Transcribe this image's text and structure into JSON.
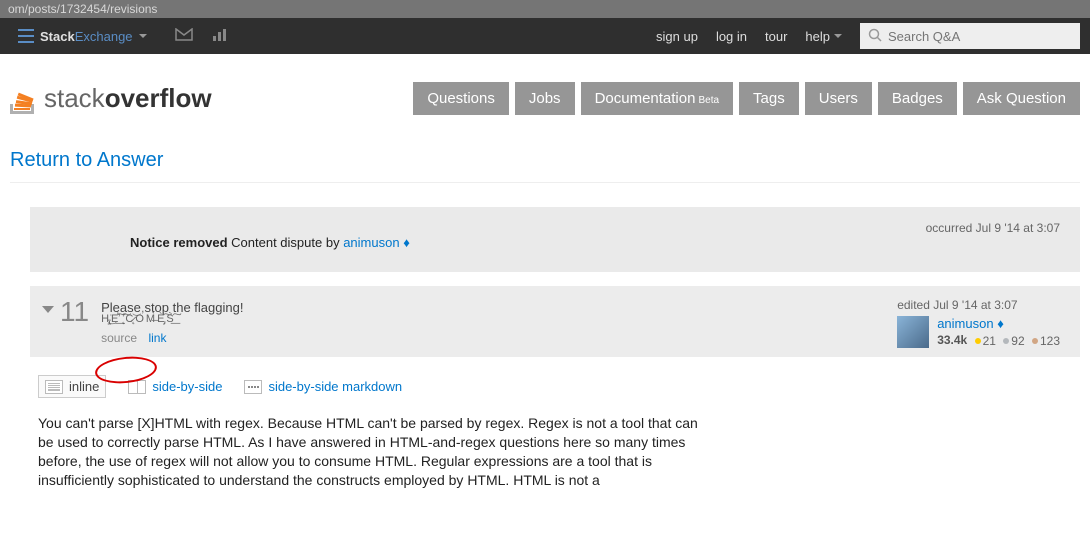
{
  "url_fragment": "om/posts/1732454/revisions",
  "topbar": {
    "network_label_bold": "Stack",
    "network_label_light": "Exchange",
    "signup": "sign up",
    "login": "log in",
    "tour": "tour",
    "help": "help",
    "search_placeholder": "Search Q&A"
  },
  "logo": {
    "light": "stack",
    "bold": "overflow"
  },
  "nav": {
    "questions": "Questions",
    "jobs": "Jobs",
    "documentation": "Documentation",
    "doc_beta": "Beta",
    "tags": "Tags",
    "users": "Users",
    "badges": "Badges",
    "ask": "Ask Question"
  },
  "return_link": "Return to Answer",
  "notice": {
    "occurred": "occurred Jul 9 '14 at 3:07",
    "strong": "Notice removed",
    "rest": " Content dispute by ",
    "user": "animuson",
    "diamond": "♦"
  },
  "revision": {
    "number": "11",
    "comment": "Please stop the flagging!",
    "zalgo": "H̵̡̢͘͜E̛̛͟͠ ̨̕͠C̷̨͝O͏͏̕M̶͏̀È̡͠S̀͟͠",
    "source": "source",
    "link": "link",
    "edited": "edited Jul 9 '14 at 3:07",
    "user": "animuson",
    "diamond": "♦",
    "rep": "33.4k",
    "gold": "21",
    "silver": "92",
    "bronze": "123"
  },
  "modes": {
    "inline": "inline",
    "sbs": "side-by-side",
    "sbs_md": "side-by-side markdown"
  },
  "body": "You can't parse [X]HTML with regex. Because HTML can't be parsed by regex. Regex is not a tool that can be used to correctly parse HTML. As I have answered in HTML-and-regex questions here so many times before, the use of regex will not allow you to consume HTML. Regular expressions are a tool that is insufficiently sophisticated to understand the constructs employed by HTML. HTML is not a"
}
